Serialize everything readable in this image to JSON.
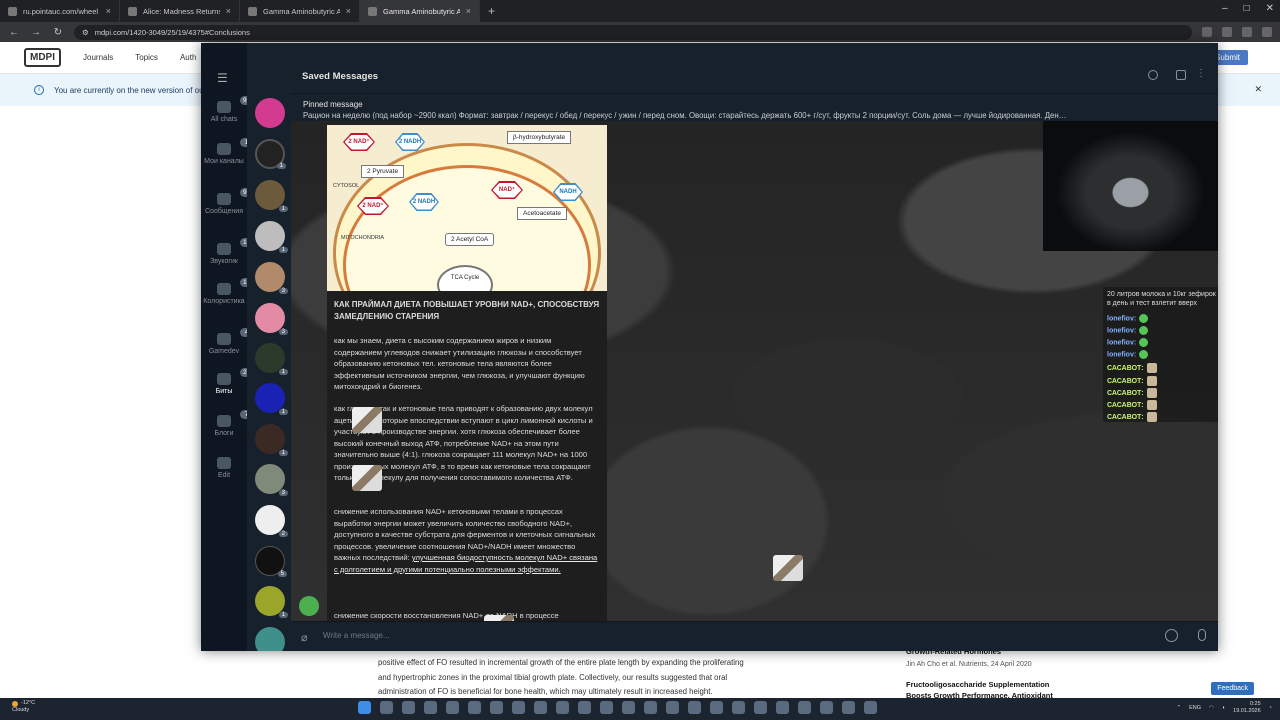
{
  "browser": {
    "tabs": [
      {
        "title": "ru.pointauc.com/wheel"
      },
      {
        "title": "Alice: Madness Returns - Goog"
      },
      {
        "title": "Gamma Aminobutyric Acid-Enr"
      },
      {
        "title": "Gamma Aminobutyric Acid-Enr"
      }
    ],
    "url": "mdpi.com/1420-3049/25/19/4375#Conclusions"
  },
  "mdpi": {
    "logo": "MDPI",
    "nav": [
      "Journals",
      "Topics",
      "Auth"
    ],
    "submit": "Submit",
    "banner": "You are currently on the new version of ou",
    "body_lines": [
      "positive effect of FO resulted in incremental growth of the entire plate length by expanding the proliferating",
      "and hypertrophic zones in the proximal tibial growth plate. Collectively, our results suggested that oral",
      "administration of FO is beneficial for bone health, which may ultimately result in increased height."
    ],
    "side": {
      "article1": "Growth-Related Hormones",
      "meta1": "Jin Ah Cho et al. Nutrients, 24 April 2020",
      "article2": "Fructooligosaccharide Supplementation",
      "article3": "Boosts Growth Performance, Antioxidant"
    },
    "feedback": "Feedback"
  },
  "telegram": {
    "folders": [
      {
        "label": "All chats",
        "badge": "99+"
      },
      {
        "label": "Мои каналы",
        "badge": "1"
      },
      {
        "label": "Сообщения",
        "badge": "99+"
      },
      {
        "label": "Звукогик",
        "badge": "19"
      },
      {
        "label": "Колористика",
        "badge": "19"
      },
      {
        "label": "Gamedev",
        "badge": "4"
      },
      {
        "label": "Биты",
        "badge": "22"
      },
      {
        "label": "Блоги",
        "badge": "7"
      },
      {
        "label": "Edit",
        "badge": ""
      }
    ],
    "chat_counts": [
      "",
      "1",
      "1",
      "1",
      "3",
      "3",
      "1",
      "1",
      "1",
      "3",
      "2",
      "5",
      "1",
      ""
    ],
    "header_title": "Saved Messages",
    "pinned_label": "Pinned message",
    "pinned_text": "Рацион на неделю (под набор ~2900 ккал)  Формат: завтрак / перекус / обед / перекус / ужин / перед сном. Овощи: старайтесь держать 600+ г/сут, фрукты 2 порции/сут. Соль дома — лучше йодированная.  Ден…",
    "diagram": {
      "nad_plus": "NAD⁺",
      "nadh": "NADH",
      "n2nad_plus": "2 NAD⁺",
      "n2nadh": "2 NADH",
      "pyruvate": "2 Pyruvate",
      "bhb": "β-hydroxybutyrate",
      "acetoacetate": "Acetoacetate",
      "acetyl": "2 Acetyl CoA",
      "cytosol": "CYTOSOL",
      "mito": "MITOCHONDRIA",
      "tca": "TCA Cycle"
    },
    "message": {
      "title": "КАК ПРАЙМАЛ ДИЕТА ПОВЫШАЕТ УРОВНИ NAD+, СПОСОБСТВУЯ ЗАМЕДЛЕНИЮ СТАРЕНИЯ",
      "p1": "как мы знаем, диета с высоким содержанием жиров и низким содержанием углеводов снижает утилизацию глюкозы и способствует образованию кетоновых тел. кетоновые тела являются более эффективным источником энергии, чем глюкоза, и улучшают функцию митохондрий и биогенез.",
      "p2": "как глюкоза, так и кетоновые тела приводят к образованию двух молекул ацетил-КоА, которые впоследствии вступают в цикл лимонной кислоты и участвуют в производстве энергии. хотя глюкоза обеспечивает более высокий конечный выход АТФ, потребление NAD+ на этом пути значительно выше (4:1). глюкоза сокращает 111 молекул NAD+ на 1000 произведенных молекул АТФ, в то время как кетоновые тела сокращают только 41 молекулу для получения сопоставимого количества АТФ.",
      "p3": "снижение использования NAD+ кетоновыми телами в процессах выработки энергии может увеличить количество свободного NAD+, доступного в качестве субстрата для ферментов и клеточных сигнальных процессов. увеличение соотношения NAD+/NADH имеет множество важных последствий: ",
      "p3_link": "улучшенная биодоступность молекул NAD+ связана с долголетием и другими потенциально полезными эффектами.",
      "p4": "снижение скорости восстановления NAD+ до NADH в процессе"
    },
    "composer_placeholder": "Write a message..."
  },
  "stream_chat": {
    "top": "20 литров молока и 10кг зефирок в день и тест взлетит вверх",
    "lines": [
      {
        "nick": "lonefiov:",
        "kind": "a"
      },
      {
        "nick": "lonefiov:",
        "kind": "a"
      },
      {
        "nick": "lonefiov:",
        "kind": "a"
      },
      {
        "nick": "lonefiov:",
        "kind": "a"
      },
      {
        "nick": "САСАВОТ:",
        "kind": "b"
      },
      {
        "nick": "САСАВОТ:",
        "kind": "b"
      },
      {
        "nick": "САСАВОТ:",
        "kind": "b"
      },
      {
        "nick": "САСАВОТ:",
        "kind": "b"
      },
      {
        "nick": "САСАВОТ:",
        "kind": "b"
      }
    ]
  },
  "taskbar": {
    "temp": "-12°C",
    "weather": "Cloudy",
    "lang": "ENG",
    "time": "0:25",
    "date": "19.01.2026"
  }
}
